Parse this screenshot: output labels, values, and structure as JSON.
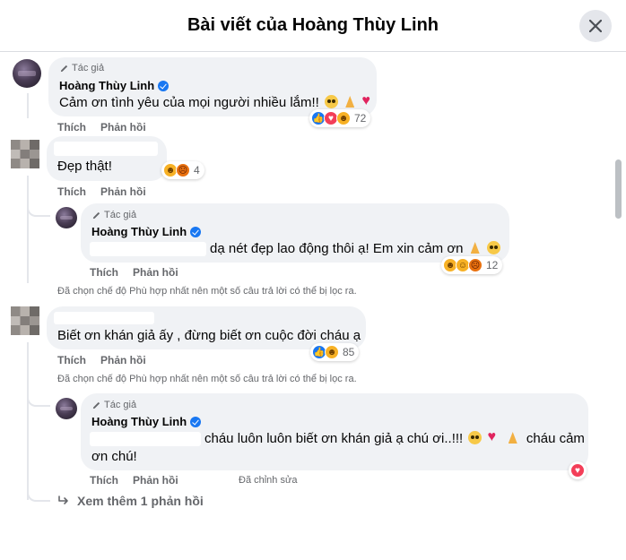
{
  "header": {
    "title": "Bài viết của Hoàng Thùy Linh"
  },
  "comments": [
    {
      "author_badge": "Tác giả",
      "author": "Hoàng Thùy Linh",
      "text": "Cảm ơn tình yêu của mọi người nhiều lắm!!",
      "actions": {
        "like": "Thích",
        "reply": "Phản hồi"
      },
      "reactions": {
        "icons": [
          "like-reaction",
          "love-reaction",
          "haha-reaction"
        ],
        "count": "72"
      }
    },
    {
      "author": "",
      "text": "Đẹp thật!",
      "actions": {
        "like": "Thích",
        "reply": "Phản hồi"
      },
      "reactions": {
        "icons": [
          "haha-reaction",
          "angry-reaction"
        ],
        "count": "4"
      },
      "reply": {
        "author_badge": "Tác giả",
        "author": "Hoàng Thùy Linh",
        "text": "dạ nét đẹp lao động thôi ạ! Em xin cảm ơn",
        "actions": {
          "like": "Thích",
          "reply": "Phản hồi"
        },
        "reactions": {
          "icons": [
            "haha-reaction",
            "care-reaction",
            "angry-reaction"
          ],
          "count": "12"
        }
      },
      "filter_note": "Đã chọn chế độ Phù hợp nhất nên một số câu trả lời có thể bị lọc ra."
    },
    {
      "author": "",
      "text": "Biết ơn khán giả ấy , đừng biết ơn cuộc đời cháu ạ",
      "actions": {
        "like": "Thích",
        "reply": "Phản hồi"
      },
      "reactions": {
        "icons": [
          "like-reaction",
          "haha-reaction"
        ],
        "count": "85"
      },
      "filter_note": "Đã chọn chế độ Phù hợp nhất nên một số câu trả lời có thể bị lọc ra.",
      "reply": {
        "author_badge": "Tác giả",
        "author": "Hoàng Thùy Linh",
        "text_line1": "cháu luôn luôn biết ơn khán giả ạ chú ơi..!!!",
        "text_line1b": "cháu cảm",
        "text_line2": "ơn chú!",
        "actions": {
          "like": "Thích",
          "reply": "Phản hồi"
        },
        "edited": "Đã chỉnh sửa",
        "reactions": {
          "icons": [
            "love-reaction"
          ],
          "count": ""
        }
      }
    }
  ],
  "more_replies": "Xem thêm 1 phản hồi",
  "colors": {
    "accent": "#1877f2",
    "bubble": "#f0f2f5",
    "secondary_text": "#65676b"
  }
}
